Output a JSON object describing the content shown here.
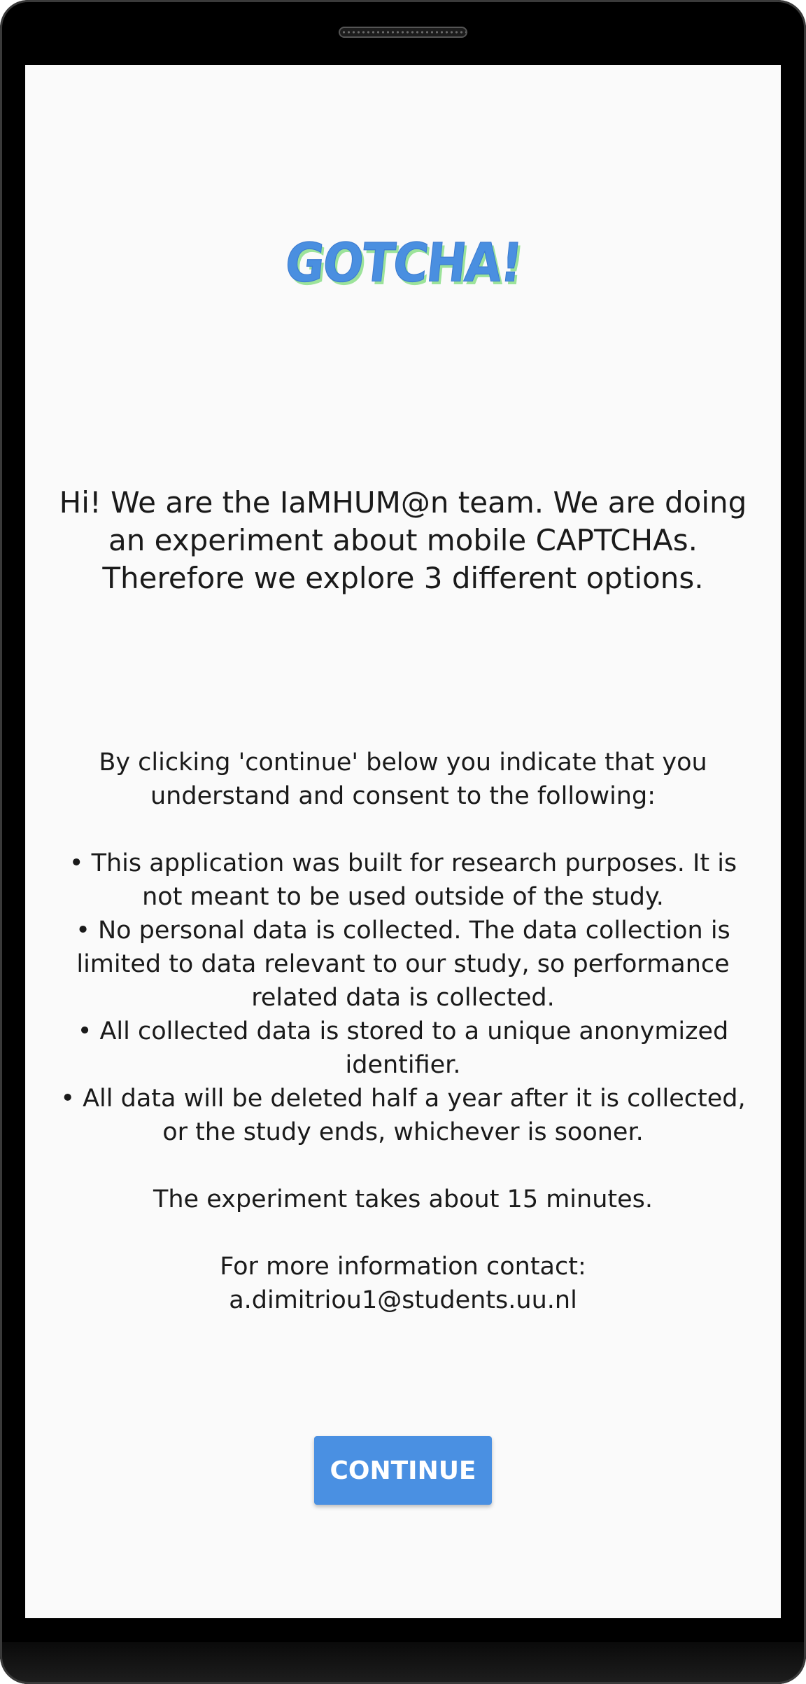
{
  "app": {
    "logo_text": "GOTCHA!",
    "accent_color": "#4a90e2",
    "logo_shadow_color": "#9ce39a"
  },
  "intro": {
    "text": "Hi! We are the IaMHUM@n team. We are doing an experiment about mobile CAPTCHAs. Therefore we explore 3 different options."
  },
  "consent": {
    "lead": "By clicking 'continue' below you indicate that you understand and consent to the following:",
    "bullets": [
      "• This application was built for research purposes. It is not meant to be used outside of the study.",
      "• No personal data is collected. The data collection is limited to data relevant to our study, so performance related data is collected.",
      "• All collected data is stored to a unique anonymized identifier.",
      "• All data will be deleted half a year after it is collected, or the study ends, whichever is sooner."
    ],
    "duration": "The experiment takes about 15 minutes.",
    "contact_label": "For more information contact:",
    "contact_email": "a.dimitriou1@students.uu.nl"
  },
  "actions": {
    "continue_label": "CONTINUE"
  }
}
